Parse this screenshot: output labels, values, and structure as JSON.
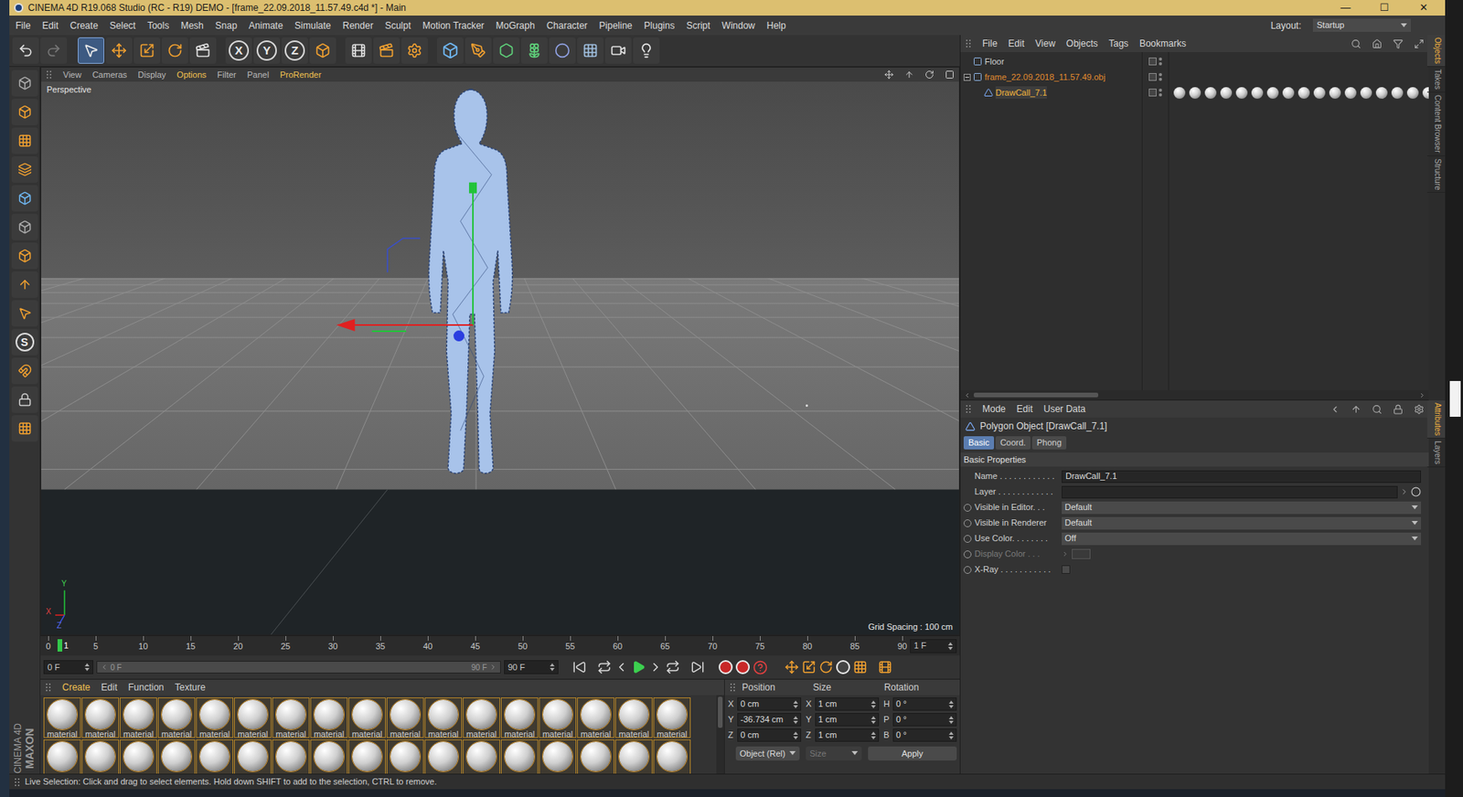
{
  "window": {
    "title": "CINEMA 4D R19.068 Studio (RC - R19) DEMO - [frame_22.09.2018_11.57.49.c4d *] - Main",
    "controls": [
      "—",
      "☐",
      "✕"
    ]
  },
  "menu": [
    "File",
    "Edit",
    "Create",
    "Select",
    "Tools",
    "Mesh",
    "Snap",
    "Animate",
    "Simulate",
    "Render",
    "Sculpt",
    "Motion Tracker",
    "MoGraph",
    "Character",
    "Pipeline",
    "Plugins",
    "Script",
    "Window",
    "Help"
  ],
  "layout": {
    "label": "Layout:",
    "value": "Startup"
  },
  "toolbar": {
    "axis_buttons": [
      "X",
      "Y",
      "Z"
    ]
  },
  "tools": {
    "snap": "S"
  },
  "logo": {
    "brand": "MAXON",
    "product": "CINEMA 4D"
  },
  "viewport": {
    "menu": [
      {
        "label": "View",
        "highlighted": false
      },
      {
        "label": "Cameras",
        "highlighted": false
      },
      {
        "label": "Display",
        "highlighted": false
      },
      {
        "label": "Options",
        "highlighted": true
      },
      {
        "label": "Filter",
        "highlighted": false
      },
      {
        "label": "Panel",
        "highlighted": false
      },
      {
        "label": "ProRender",
        "highlighted": true
      }
    ],
    "camera": "Perspective",
    "grid_spacing": "Grid Spacing : 100 cm",
    "axes": [
      "Y",
      "X",
      "Z"
    ]
  },
  "timeline": {
    "ticks": [
      "0",
      "5",
      "10",
      "15",
      "20",
      "25",
      "30",
      "35",
      "40",
      "45",
      "50",
      "55",
      "60",
      "65",
      "70",
      "75",
      "80",
      "85",
      "90"
    ],
    "playhead": {
      "label": "1",
      "level": 0.011
    },
    "current_frame": "1 F",
    "start": "0 F",
    "range_start": "0 F",
    "range_end": "90 F",
    "end": "90 F"
  },
  "materials": {
    "menu": [
      "Create",
      "Edit",
      "Function",
      "Texture"
    ],
    "rows": [
      [
        {
          "label": "material",
          "selected": true
        },
        {
          "label": "material",
          "selected": true
        },
        {
          "label": "material",
          "selected": true
        },
        {
          "label": "material",
          "selected": true
        },
        {
          "label": "material",
          "selected": true
        },
        {
          "label": "material",
          "selected": true
        },
        {
          "label": "material",
          "selected": true
        },
        {
          "label": "material",
          "selected": true
        },
        {
          "label": "material",
          "selected": true
        },
        {
          "label": "material",
          "selected": true
        },
        {
          "label": "material",
          "selected": true
        },
        {
          "label": "material",
          "selected": true
        },
        {
          "label": "material",
          "selected": true
        },
        {
          "label": "material",
          "selected": true
        },
        {
          "label": "material",
          "selected": true
        },
        {
          "label": "material",
          "selected": true
        },
        {
          "label": "material",
          "selected": true
        }
      ],
      [
        {
          "label": "",
          "selected": true
        },
        {
          "label": "",
          "selected": true
        },
        {
          "label": "",
          "selected": true
        },
        {
          "label": "",
          "selected": true
        },
        {
          "label": "",
          "selected": true
        },
        {
          "label": "",
          "selected": true
        },
        {
          "label": "",
          "selected": true
        },
        {
          "label": "",
          "selected": true
        },
        {
          "label": "",
          "selected": true
        },
        {
          "label": "",
          "selected": true
        },
        {
          "label": "",
          "selected": true
        },
        {
          "label": "",
          "selected": true
        },
        {
          "label": "",
          "selected": true
        },
        {
          "label": "",
          "selected": true
        },
        {
          "label": "",
          "selected": true
        },
        {
          "label": "",
          "selected": true
        },
        {
          "label": "",
          "selected": true
        }
      ]
    ]
  },
  "coordinates": {
    "headers": [
      "Position",
      "Size",
      "Rotation"
    ],
    "rows": [
      {
        "pos_axis": "X",
        "pos": "0 cm",
        "size_axis": "X",
        "size": "1 cm",
        "rot_axis": "H",
        "rot": "0 °"
      },
      {
        "pos_axis": "Y",
        "pos": "-36.734 cm",
        "size_axis": "Y",
        "size": "1 cm",
        "rot_axis": "P",
        "rot": "0 °"
      },
      {
        "pos_axis": "Z",
        "pos": "0 cm",
        "size_axis": "Z",
        "size": "1 cm",
        "rot_axis": "B",
        "rot": "0 °"
      }
    ],
    "mode": "Object (Rel)",
    "size_mode": "Size",
    "apply": "Apply"
  },
  "objects": {
    "menu": [
      "File",
      "Edit",
      "View",
      "Objects",
      "Tags",
      "Bookmarks"
    ],
    "items": [
      {
        "name": "Floor",
        "depth": 0,
        "expandable": false,
        "expanded": false,
        "selected": false,
        "color": "#cfcfcf",
        "material_tags": 0
      },
      {
        "name": "frame_22.09.2018_11.57.49.obj",
        "depth": 0,
        "expandable": true,
        "expanded": true,
        "selected": false,
        "color": "#e08a2e",
        "material_tags": 0
      },
      {
        "name": "DrawCall_7.1",
        "depth": 1,
        "expandable": false,
        "expanded": false,
        "selected": true,
        "color": "#f2b53c",
        "material_tags": 18
      }
    ]
  },
  "attributes": {
    "menu": [
      "Mode",
      "Edit",
      "User Data"
    ],
    "title": "Polygon Object [DrawCall_7.1]",
    "tabs": [
      {
        "label": "Basic",
        "selected": true
      },
      {
        "label": "Coord.",
        "selected": false
      },
      {
        "label": "Phong",
        "selected": false
      }
    ],
    "section": "Basic Properties",
    "fields": [
      {
        "label": "Name . . . . . . . . . . . .",
        "value": "DrawCall_7.1",
        "kind": "text",
        "animatable": false,
        "disabled": false
      },
      {
        "label": "Layer . . . . . . . . . . . .",
        "value": "",
        "kind": "link",
        "animatable": false,
        "disabled": false
      },
      {
        "label": "Visible in Editor. . .",
        "value": "Default",
        "kind": "dropdown",
        "animatable": true,
        "disabled": false
      },
      {
        "label": "Visible in Renderer",
        "value": "Default",
        "kind": "dropdown",
        "animatable": true,
        "disabled": false
      },
      {
        "label": "Use Color. . . . . . . .",
        "value": "Off",
        "kind": "dropdown",
        "animatable": true,
        "disabled": false
      },
      {
        "label": "Display Color . . .",
        "value": "",
        "kind": "color",
        "animatable": true,
        "disabled": true
      },
      {
        "label": "X-Ray . . . . . . . . . . .",
        "value": "",
        "kind": "checkbox",
        "animatable": true,
        "disabled": false,
        "checked": false
      }
    ]
  },
  "side_tabs": {
    "top": [
      {
        "label": "Objects",
        "selected": true
      },
      {
        "label": "Takes",
        "selected": false
      },
      {
        "label": "Content Browser",
        "selected": false
      },
      {
        "label": "Structure",
        "selected": false
      }
    ],
    "bottom": [
      {
        "label": "Attributes",
        "selected": true
      },
      {
        "label": "Layers",
        "selected": false
      }
    ]
  },
  "status": "Live Selection: Click and drag to select elements. Hold down SHIFT to add to the selection, CTRL to remove."
}
